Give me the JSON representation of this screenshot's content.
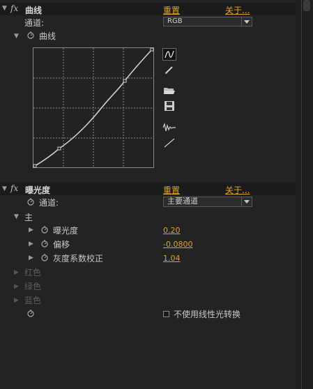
{
  "curves": {
    "fx_label": "fx",
    "title": "曲线",
    "reset": "重置",
    "about": "关于...",
    "channel_label": "通道:",
    "channel_value": "RGB",
    "curve_label": "曲线"
  },
  "exposure": {
    "fx_label": "fx",
    "title": "曝光度",
    "reset": "重置",
    "about": "关于...",
    "channel_label": "通道:",
    "channel_value": "主要通道",
    "main_label": "主",
    "params": [
      {
        "label": "曝光度",
        "value": "0.20"
      },
      {
        "label": "偏移",
        "value": "-0.0800"
      },
      {
        "label": "灰度系数校正",
        "value": "1.04"
      }
    ],
    "channels": [
      "红色",
      "绿色",
      "蓝色"
    ],
    "linear_checkbox_label": "不使用线性光转换"
  },
  "colors": {
    "accent": "#e0a42a",
    "panel_bg": "#232323",
    "header_bg": "#1b1b1b"
  },
  "icons": [
    "stopwatch-icon",
    "curve-tool-icon",
    "pencil-icon",
    "open-folder-icon",
    "save-icon",
    "smooth-icon",
    "linear-icon"
  ]
}
